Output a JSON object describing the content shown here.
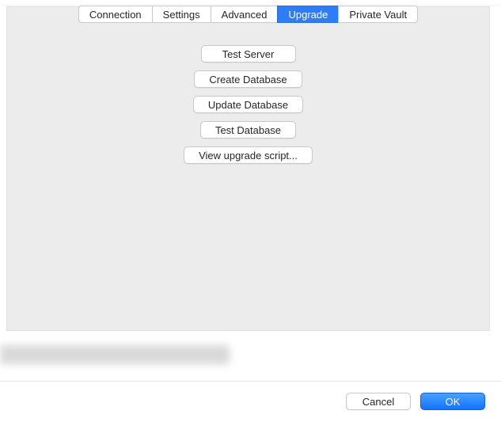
{
  "tabs": {
    "connection": "Connection",
    "settings": "Settings",
    "advanced": "Advanced",
    "upgrade": "Upgrade",
    "private_vault": "Private Vault",
    "active": "upgrade"
  },
  "actions": {
    "test_server": "Test Server",
    "create_database": "Create Database",
    "update_database": "Update Database",
    "test_database": "Test Database",
    "view_upgrade_script": "View upgrade script..."
  },
  "footer": {
    "cancel": "Cancel",
    "ok": "OK"
  }
}
